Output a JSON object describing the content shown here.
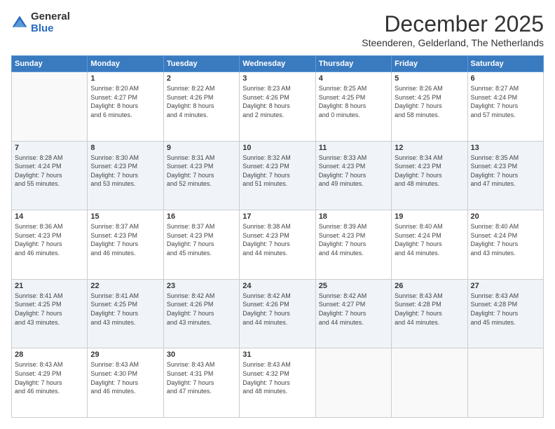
{
  "logo": {
    "general": "General",
    "blue": "Blue"
  },
  "title": {
    "month": "December 2025",
    "location": "Steenderen, Gelderland, The Netherlands"
  },
  "headers": [
    "Sunday",
    "Monday",
    "Tuesday",
    "Wednesday",
    "Thursday",
    "Friday",
    "Saturday"
  ],
  "weeks": [
    [
      {
        "day": "",
        "info": ""
      },
      {
        "day": "1",
        "info": "Sunrise: 8:20 AM\nSunset: 4:27 PM\nDaylight: 8 hours\nand 6 minutes."
      },
      {
        "day": "2",
        "info": "Sunrise: 8:22 AM\nSunset: 4:26 PM\nDaylight: 8 hours\nand 4 minutes."
      },
      {
        "day": "3",
        "info": "Sunrise: 8:23 AM\nSunset: 4:26 PM\nDaylight: 8 hours\nand 2 minutes."
      },
      {
        "day": "4",
        "info": "Sunrise: 8:25 AM\nSunset: 4:25 PM\nDaylight: 8 hours\nand 0 minutes."
      },
      {
        "day": "5",
        "info": "Sunrise: 8:26 AM\nSunset: 4:25 PM\nDaylight: 7 hours\nand 58 minutes."
      },
      {
        "day": "6",
        "info": "Sunrise: 8:27 AM\nSunset: 4:24 PM\nDaylight: 7 hours\nand 57 minutes."
      }
    ],
    [
      {
        "day": "7",
        "info": "Sunrise: 8:28 AM\nSunset: 4:24 PM\nDaylight: 7 hours\nand 55 minutes."
      },
      {
        "day": "8",
        "info": "Sunrise: 8:30 AM\nSunset: 4:23 PM\nDaylight: 7 hours\nand 53 minutes."
      },
      {
        "day": "9",
        "info": "Sunrise: 8:31 AM\nSunset: 4:23 PM\nDaylight: 7 hours\nand 52 minutes."
      },
      {
        "day": "10",
        "info": "Sunrise: 8:32 AM\nSunset: 4:23 PM\nDaylight: 7 hours\nand 51 minutes."
      },
      {
        "day": "11",
        "info": "Sunrise: 8:33 AM\nSunset: 4:23 PM\nDaylight: 7 hours\nand 49 minutes."
      },
      {
        "day": "12",
        "info": "Sunrise: 8:34 AM\nSunset: 4:23 PM\nDaylight: 7 hours\nand 48 minutes."
      },
      {
        "day": "13",
        "info": "Sunrise: 8:35 AM\nSunset: 4:23 PM\nDaylight: 7 hours\nand 47 minutes."
      }
    ],
    [
      {
        "day": "14",
        "info": "Sunrise: 8:36 AM\nSunset: 4:23 PM\nDaylight: 7 hours\nand 46 minutes."
      },
      {
        "day": "15",
        "info": "Sunrise: 8:37 AM\nSunset: 4:23 PM\nDaylight: 7 hours\nand 46 minutes."
      },
      {
        "day": "16",
        "info": "Sunrise: 8:37 AM\nSunset: 4:23 PM\nDaylight: 7 hours\nand 45 minutes."
      },
      {
        "day": "17",
        "info": "Sunrise: 8:38 AM\nSunset: 4:23 PM\nDaylight: 7 hours\nand 44 minutes."
      },
      {
        "day": "18",
        "info": "Sunrise: 8:39 AM\nSunset: 4:23 PM\nDaylight: 7 hours\nand 44 minutes."
      },
      {
        "day": "19",
        "info": "Sunrise: 8:40 AM\nSunset: 4:24 PM\nDaylight: 7 hours\nand 44 minutes."
      },
      {
        "day": "20",
        "info": "Sunrise: 8:40 AM\nSunset: 4:24 PM\nDaylight: 7 hours\nand 43 minutes."
      }
    ],
    [
      {
        "day": "21",
        "info": "Sunrise: 8:41 AM\nSunset: 4:25 PM\nDaylight: 7 hours\nand 43 minutes."
      },
      {
        "day": "22",
        "info": "Sunrise: 8:41 AM\nSunset: 4:25 PM\nDaylight: 7 hours\nand 43 minutes."
      },
      {
        "day": "23",
        "info": "Sunrise: 8:42 AM\nSunset: 4:26 PM\nDaylight: 7 hours\nand 43 minutes."
      },
      {
        "day": "24",
        "info": "Sunrise: 8:42 AM\nSunset: 4:26 PM\nDaylight: 7 hours\nand 44 minutes."
      },
      {
        "day": "25",
        "info": "Sunrise: 8:42 AM\nSunset: 4:27 PM\nDaylight: 7 hours\nand 44 minutes."
      },
      {
        "day": "26",
        "info": "Sunrise: 8:43 AM\nSunset: 4:28 PM\nDaylight: 7 hours\nand 44 minutes."
      },
      {
        "day": "27",
        "info": "Sunrise: 8:43 AM\nSunset: 4:28 PM\nDaylight: 7 hours\nand 45 minutes."
      }
    ],
    [
      {
        "day": "28",
        "info": "Sunrise: 8:43 AM\nSunset: 4:29 PM\nDaylight: 7 hours\nand 46 minutes."
      },
      {
        "day": "29",
        "info": "Sunrise: 8:43 AM\nSunset: 4:30 PM\nDaylight: 7 hours\nand 46 minutes."
      },
      {
        "day": "30",
        "info": "Sunrise: 8:43 AM\nSunset: 4:31 PM\nDaylight: 7 hours\nand 47 minutes."
      },
      {
        "day": "31",
        "info": "Sunrise: 8:43 AM\nSunset: 4:32 PM\nDaylight: 7 hours\nand 48 minutes."
      },
      {
        "day": "",
        "info": ""
      },
      {
        "day": "",
        "info": ""
      },
      {
        "day": "",
        "info": ""
      }
    ]
  ]
}
